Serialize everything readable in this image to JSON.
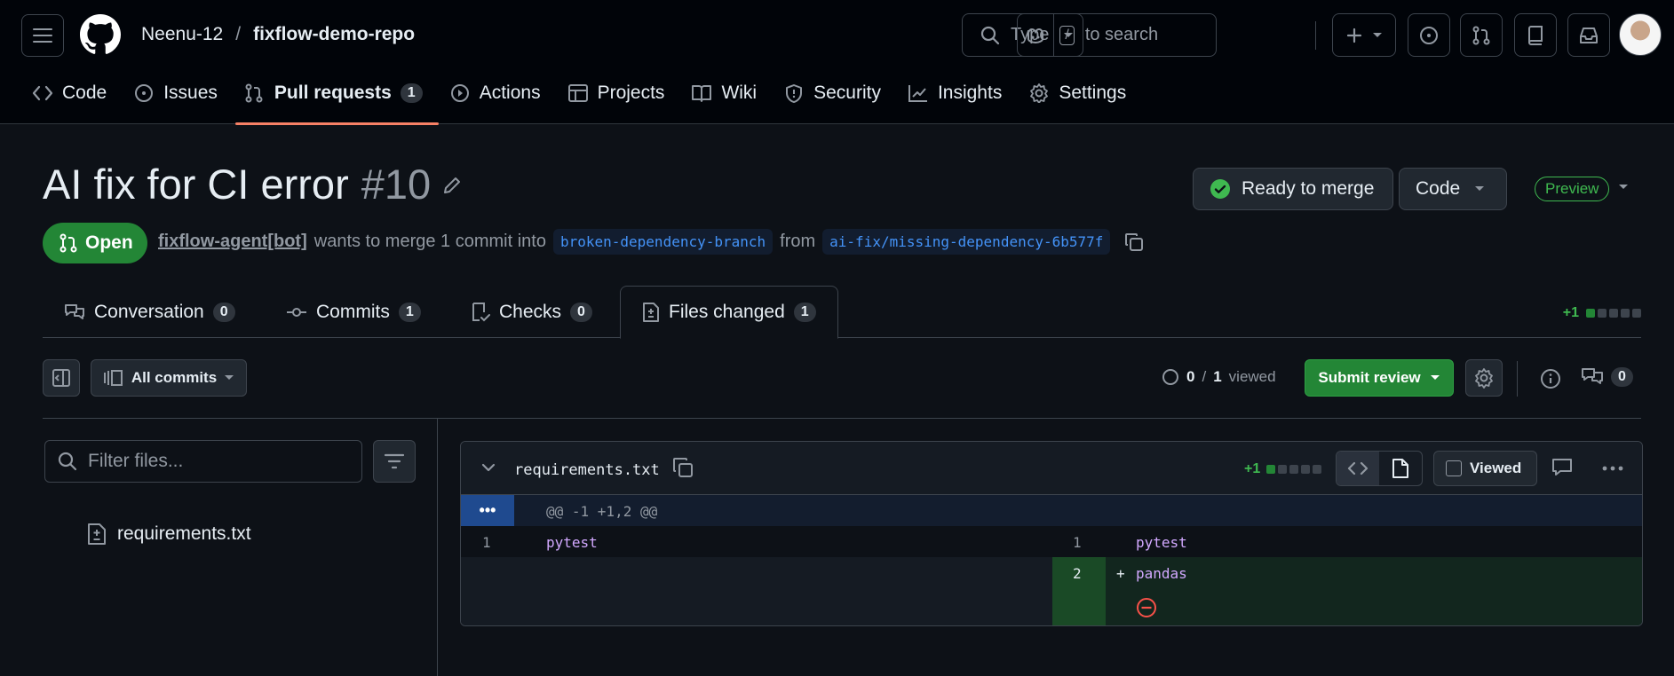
{
  "header": {
    "owner": "Neenu-12",
    "separator": "/",
    "repo": "fixflow-demo-repo",
    "search_placeholder": "Type",
    "search_kbd": "/",
    "search_suffix": "to search"
  },
  "repo_nav": [
    {
      "label": "Code",
      "icon": "code-icon"
    },
    {
      "label": "Issues",
      "icon": "issue-opened-icon"
    },
    {
      "label": "Pull requests",
      "icon": "git-pull-request-icon",
      "count": "1",
      "selected": true
    },
    {
      "label": "Actions",
      "icon": "play-icon"
    },
    {
      "label": "Projects",
      "icon": "table-icon"
    },
    {
      "label": "Wiki",
      "icon": "book-icon"
    },
    {
      "label": "Security",
      "icon": "shield-icon"
    },
    {
      "label": "Insights",
      "icon": "graph-icon"
    },
    {
      "label": "Settings",
      "icon": "gear-icon"
    }
  ],
  "pr": {
    "title": "AI fix for CI error",
    "number": "#10",
    "state": "Open",
    "author": "fixflow-agent[bot]",
    "meta_text": "wants to merge 1 commit into",
    "base_branch": "broken-dependency-branch",
    "from_text": "from",
    "head_branch": "ai-fix/missing-dependency-6b577f",
    "merge_status": "Ready to merge",
    "code_button": "Code",
    "preview_label": "Preview"
  },
  "tabs": [
    {
      "label": "Conversation",
      "count": "0",
      "icon": "comment-discussion-icon"
    },
    {
      "label": "Commits",
      "count": "1",
      "icon": "git-commit-icon"
    },
    {
      "label": "Checks",
      "count": "0",
      "icon": "checklist-icon"
    },
    {
      "label": "Files changed",
      "count": "1",
      "icon": "file-diff-icon",
      "active": true
    }
  ],
  "diffstat": {
    "text": "+1"
  },
  "toolbar": {
    "all_commits": "All commits",
    "viewed_done": "0",
    "viewed_sep": "/",
    "viewed_total": "1",
    "viewed_label": "viewed",
    "submit_review": "Submit review",
    "comments_count": "0"
  },
  "sidebar": {
    "filter_placeholder": "Filter files...",
    "files": [
      "requirements.txt"
    ]
  },
  "file_diff": {
    "filename": "requirements.txt",
    "diffstat": "+1",
    "viewed_label": "Viewed",
    "hunk_expand": "•••",
    "hunk_header": "@@ -1 +1,2 @@",
    "rows": [
      {
        "left_num": "1",
        "left_code": "pytest",
        "right_num": "1",
        "right_code": "pytest"
      },
      {
        "right_num": "2",
        "marker": "+",
        "right_code": "pandas",
        "added": true
      }
    ]
  },
  "colors": {
    "accent_open": "#238636",
    "tab_underline": "#f78166",
    "link_blue": "#4493f8",
    "add_text": "#3fb950"
  }
}
